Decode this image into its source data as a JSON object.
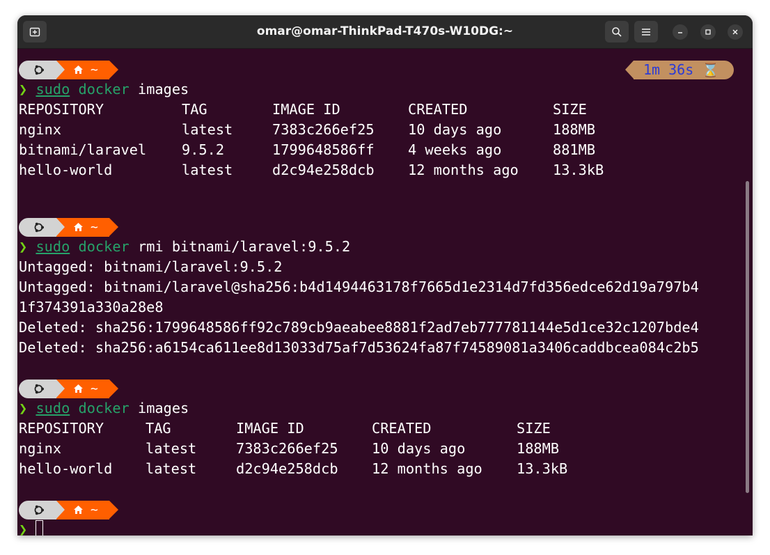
{
  "window": {
    "title": "omar@omar-ThinkPad-T470s-W10DG:~"
  },
  "icons": {
    "new_tab": "new-tab-icon",
    "search": "search-icon",
    "menu": "hamburger-menu-icon",
    "minimize": "minimize-icon",
    "maximize": "maximize-icon",
    "close": "close-icon",
    "os": "ubuntu-logo-icon",
    "home": "home-icon",
    "hourglass": "hourglass-icon"
  },
  "colors": {
    "terminal_bg": "#300a24",
    "titlebar_bg": "#2a2a2a",
    "prompt_os_segment": "#d3d3d3",
    "prompt_home_segment": "#ff5f00",
    "duration_segment": "#c29060",
    "duration_text": "#2b3bd6",
    "command_green": "#26a269",
    "chevron_green": "#73d216"
  },
  "prompt": {
    "chevron": "❯",
    "dir": "~",
    "duration": "1m 36s ⌛"
  },
  "blocks": [
    {
      "command": {
        "sudo": "sudo",
        "bin": "docker",
        "args": "images"
      },
      "table": {
        "headers": [
          "REPOSITORY",
          "TAG",
          "IMAGE ID",
          "CREATED",
          "SIZE"
        ],
        "rows": [
          [
            "nginx",
            "latest",
            "7383c266ef25",
            "10 days ago",
            "188MB"
          ],
          [
            "bitnami/laravel",
            "9.5.2",
            "1799648586ff",
            "4 weeks ago",
            "881MB"
          ],
          [
            "hello-world",
            "latest",
            "d2c94e258dcb",
            "12 months ago",
            "13.3kB"
          ]
        ]
      }
    },
    {
      "command": {
        "sudo": "sudo",
        "bin": "docker",
        "args": "rmi bitnami/laravel:9.5.2"
      },
      "output": [
        "Untagged: bitnami/laravel:9.5.2",
        "Untagged: bitnami/laravel@sha256:b4d1494463178f7665d1e2314d7fd356edce62d19a797b4",
        "1f374391a330a28e8",
        "Deleted: sha256:1799648586ff92c789cb9aeabee8881f2ad7eb777781144e5d1ce32c1207bde4",
        "Deleted: sha256:a6154ca611ee8d13033d75af7d53624fa87f74589081a3406caddbcea084c2b5"
      ]
    },
    {
      "command": {
        "sudo": "sudo",
        "bin": "docker",
        "args": "images"
      },
      "table": {
        "headers": [
          "REPOSITORY",
          "TAG",
          "IMAGE ID",
          "CREATED",
          "SIZE"
        ],
        "rows": [
          [
            "nginx",
            "latest",
            "7383c266ef25",
            "10 days ago",
            "188MB"
          ],
          [
            "hello-world",
            "latest",
            "d2c94e258dcb",
            "12 months ago",
            "13.3kB"
          ]
        ]
      }
    }
  ]
}
